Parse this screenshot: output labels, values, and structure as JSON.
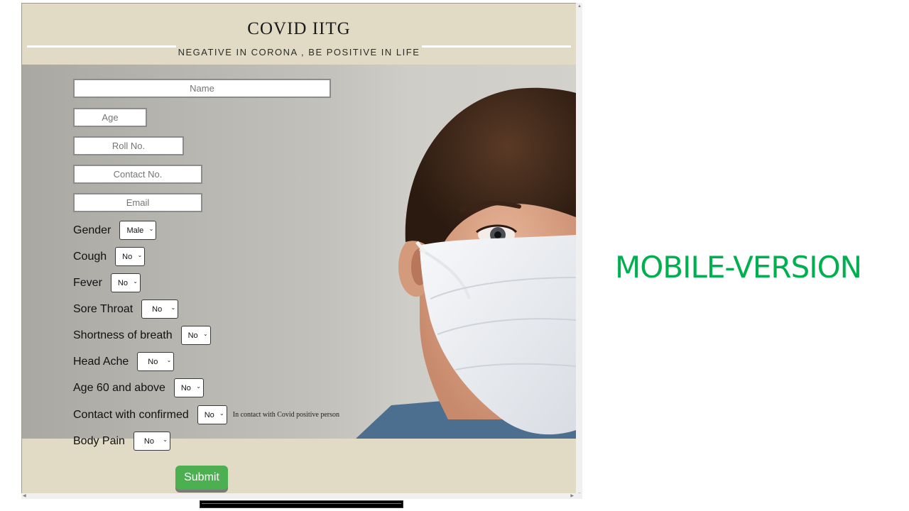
{
  "header": {
    "title": "COVID IITG",
    "subtitle": "NEGATIVE IN CORONA , BE POSITIVE IN LIFE"
  },
  "form": {
    "text_fields": [
      {
        "placeholder": "Name"
      },
      {
        "placeholder": "Age"
      },
      {
        "placeholder": "Roll No."
      },
      {
        "placeholder": "Contact No."
      },
      {
        "placeholder": "Email"
      }
    ],
    "select_fields": [
      {
        "label": "Gender",
        "value": "Male"
      },
      {
        "label": "Cough",
        "value": "No"
      },
      {
        "label": "Fever",
        "value": "No"
      },
      {
        "label": "Sore Throat",
        "value": "No"
      },
      {
        "label": "Shortness of breath",
        "value": "No"
      },
      {
        "label": "Head Ache",
        "value": "No"
      },
      {
        "label": "Age 60 and above",
        "value": "No"
      },
      {
        "label": "Contact with confirmed",
        "value": "No",
        "note": "In contact with Covid positive person"
      },
      {
        "label": "Body Pain",
        "value": "No"
      }
    ],
    "submit_label": "Submit"
  },
  "side_caption": "MOBILE-VERSION",
  "colors": {
    "page_bg": "#e1dac4",
    "submit_green": "#4caf50",
    "caption_green": "#00b050"
  },
  "icons": {
    "select_chevron": "chevron-down-icon"
  }
}
